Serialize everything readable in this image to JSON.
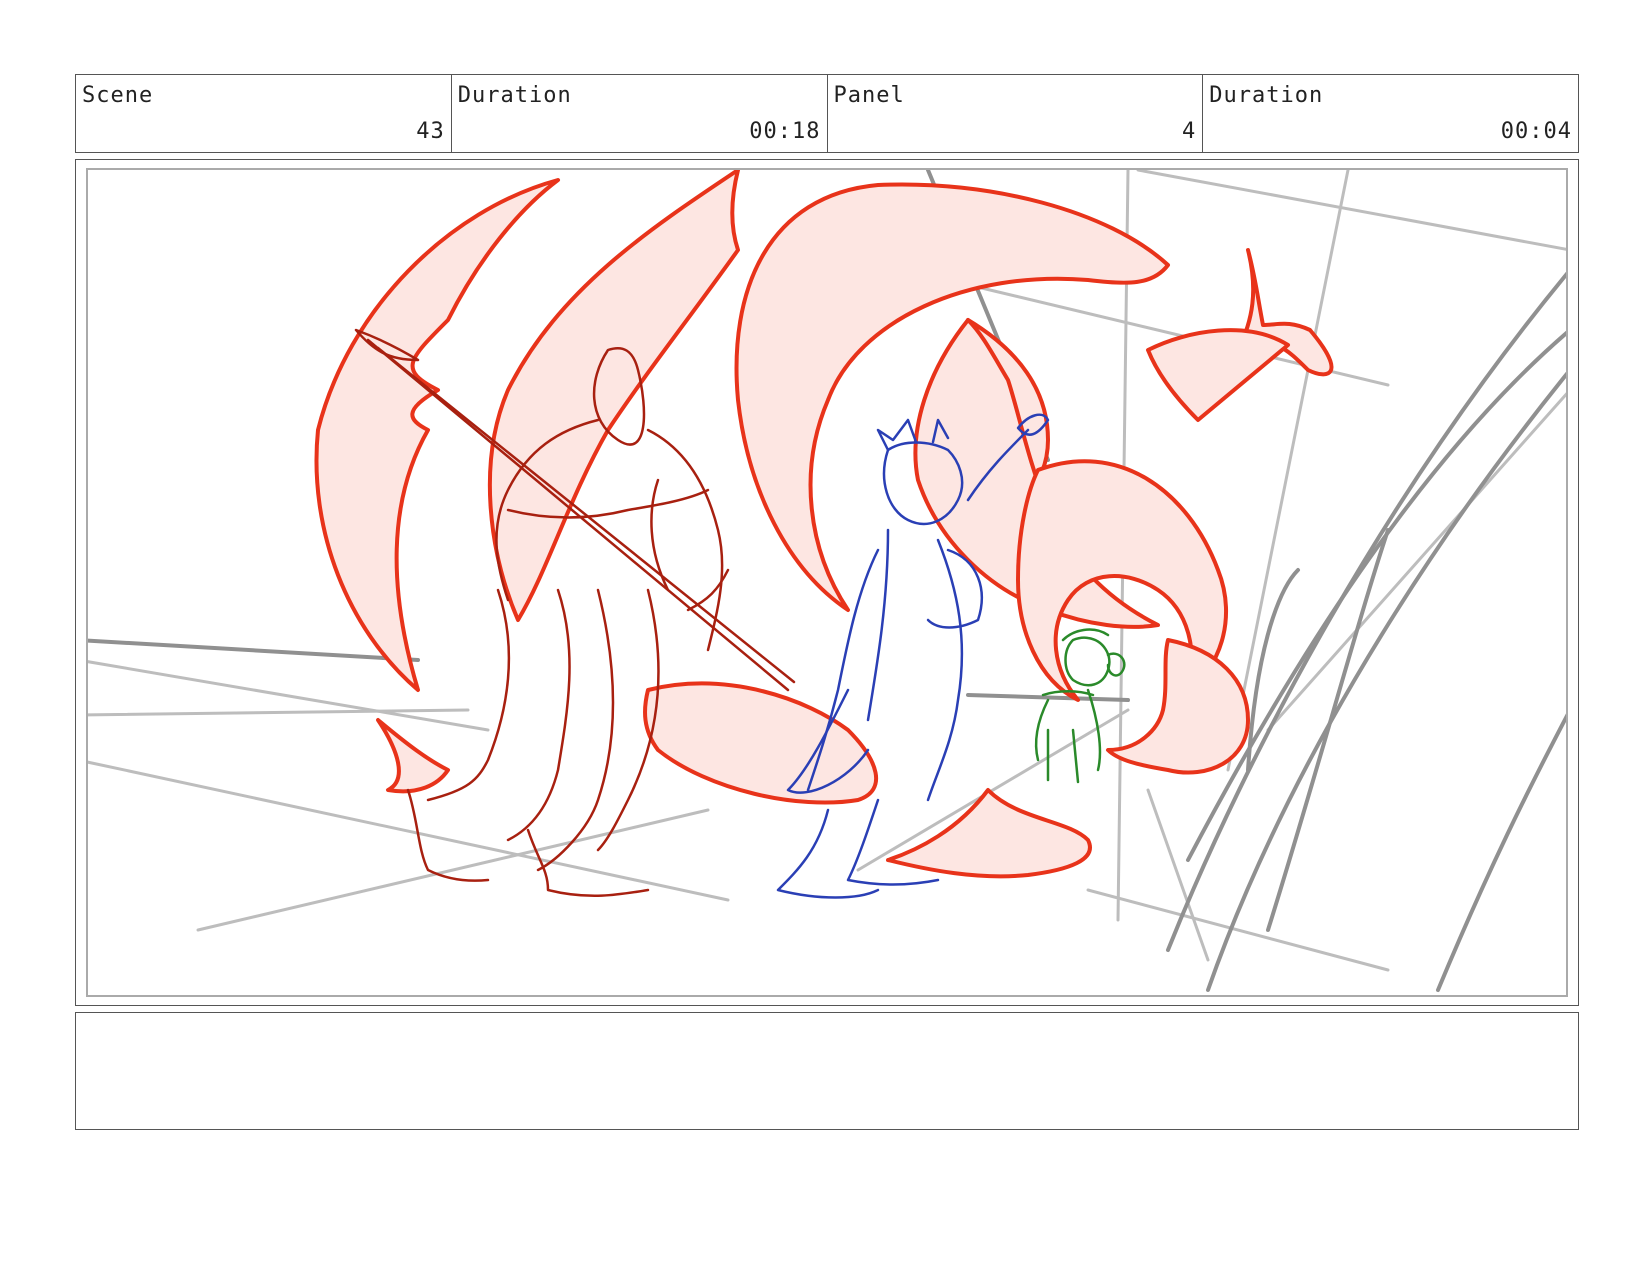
{
  "header": {
    "scene_label": "Scene",
    "scene_value": "43",
    "scene_duration_label": "Duration",
    "scene_duration_value": "00:18",
    "panel_label": "Panel",
    "panel_value": "4",
    "panel_duration_label": "Duration",
    "panel_duration_value": "00:04"
  },
  "notes": {
    "text": ""
  },
  "colors": {
    "flame_stroke": "#e8331a",
    "flame_fill": "#fde6e2",
    "character_red": "#a82010",
    "character_blue": "#2a3fb5",
    "character_green": "#2a8a2a",
    "background_lines": "#bdbdbd"
  }
}
